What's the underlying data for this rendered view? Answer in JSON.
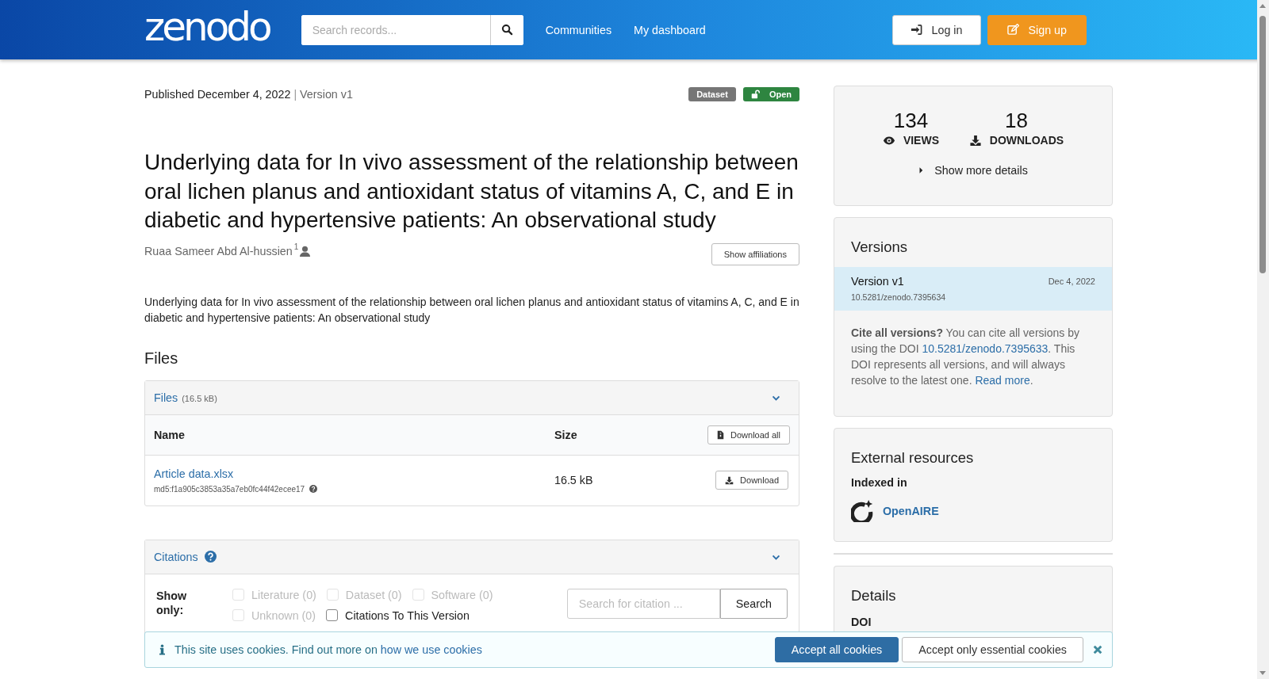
{
  "header": {
    "logo": "zenodo",
    "search": {
      "placeholder": "Search records..."
    },
    "nav": [
      "Communities",
      "My dashboard"
    ],
    "buttons": [
      {
        "kind": "login",
        "label": "Log in"
      },
      {
        "kind": "signup",
        "label": "Sign up"
      }
    ]
  },
  "record": {
    "published": "Published December 4, 2022",
    "separator": "|",
    "version": "Version v1",
    "badges": [
      {
        "kind": "type",
        "label": "Dataset"
      },
      {
        "kind": "access",
        "label": "Open"
      }
    ],
    "title": "Underlying data for In vivo assessment of the relationship between oral lichen planus and antioxidant status of vitamins A, C, and E in diabetic and hypertensive patients: An observational study",
    "creators": [
      {
        "name": "Ruaa Sameer Abd Al-hussien",
        "affiliation_mark": "1"
      }
    ],
    "show_affiliations": "Show affiliations",
    "description": "Underlying data for In vivo assessment of the relationship between oral lichen planus and antioxidant status of vitamins A, C, and E in diabetic and hypertensive patients: An observational study"
  },
  "files": {
    "heading": "Files",
    "panel_title": "Files",
    "panel_size": "(16.5 kB)",
    "expanded": true,
    "columns": [
      "Name",
      "Size"
    ],
    "download_all": "Download all",
    "rows": [
      {
        "name": "Article data.xlsx",
        "checksum": "md5:f1a905c3853a35a7eb0fc44f42ecee17",
        "size": "16.5 kB",
        "action": "Download"
      }
    ]
  },
  "citations": {
    "title": "Citations",
    "expanded": true,
    "show_only": "Show only:",
    "filters": [
      {
        "label": "Literature (0)",
        "checked": false,
        "disabled": true
      },
      {
        "label": "Dataset (0)",
        "checked": false,
        "disabled": true
      },
      {
        "label": "Software (0)",
        "checked": false,
        "disabled": true
      },
      {
        "label": "Unknown (0)",
        "checked": false,
        "disabled": true
      },
      {
        "label": "Citations To This Version",
        "checked": false,
        "disabled": false
      }
    ],
    "search": {
      "placeholder": "Search for citation ...",
      "button": "Search"
    }
  },
  "stats": {
    "items": [
      {
        "kind": "views",
        "value": "134",
        "label": "VIEWS"
      },
      {
        "kind": "downloads",
        "value": "18",
        "label": "DOWNLOADS"
      }
    ],
    "more": "Show more details"
  },
  "versions": {
    "title": "Versions",
    "items": [
      {
        "label": "Version v1",
        "date": "Dec 4, 2022",
        "doi": "10.5281/zenodo.7395634",
        "selected": true
      }
    ],
    "note": [
      {
        "kind": "text",
        "text": "**Cite all versions?** You can cite all versions by using the DOI "
      },
      {
        "kind": "link",
        "text": "10.5281/zenodo.7395633"
      },
      {
        "kind": "text",
        "text": ". This DOI represents all versions, and will always resolve to the latest one. "
      },
      {
        "kind": "link",
        "text": "Read more"
      },
      {
        "kind": "text",
        "text": "."
      }
    ]
  },
  "external": {
    "title": "External resources",
    "subtitle": "Indexed in",
    "items": [
      {
        "name": "OpenAIRE"
      }
    ]
  },
  "details": {
    "title": "Details",
    "fields": [
      "DOI"
    ]
  },
  "cookie": {
    "message": [
      {
        "kind": "text",
        "text": "This site uses cookies. Find out more on "
      },
      {
        "kind": "link",
        "text": "how we use cookies"
      }
    ],
    "buttons": [
      {
        "kind": "primary",
        "label": "Accept all cookies"
      },
      {
        "kind": "secondary",
        "label": "Accept only essential cookies"
      }
    ]
  }
}
